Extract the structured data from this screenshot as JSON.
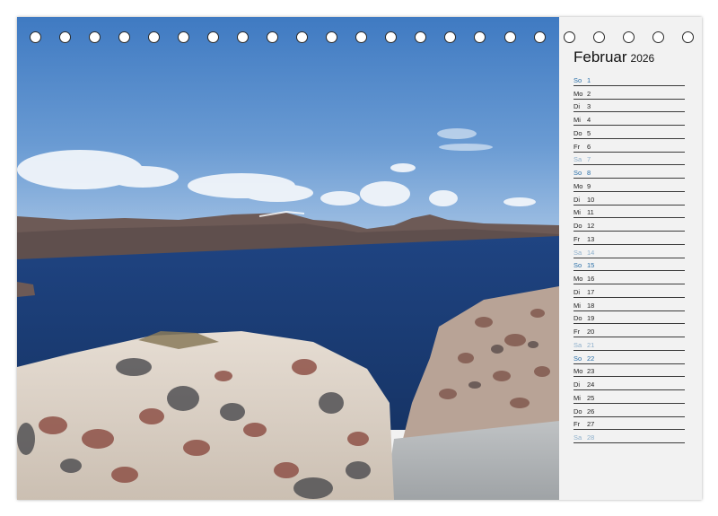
{
  "calendar": {
    "month": "Februar",
    "year": "2026",
    "days": [
      {
        "wd": "So",
        "d": "1",
        "type": "sun"
      },
      {
        "wd": "Mo",
        "d": "2",
        "type": "normal"
      },
      {
        "wd": "Di",
        "d": "3",
        "type": "normal"
      },
      {
        "wd": "Mi",
        "d": "4",
        "type": "normal"
      },
      {
        "wd": "Do",
        "d": "5",
        "type": "normal"
      },
      {
        "wd": "Fr",
        "d": "6",
        "type": "normal"
      },
      {
        "wd": "Sa",
        "d": "7",
        "type": "sat"
      },
      {
        "wd": "So",
        "d": "8",
        "type": "sun"
      },
      {
        "wd": "Mo",
        "d": "9",
        "type": "normal"
      },
      {
        "wd": "Di",
        "d": "10",
        "type": "normal"
      },
      {
        "wd": "Mi",
        "d": "11",
        "type": "normal"
      },
      {
        "wd": "Do",
        "d": "12",
        "type": "normal"
      },
      {
        "wd": "Fr",
        "d": "13",
        "type": "normal"
      },
      {
        "wd": "Sa",
        "d": "14",
        "type": "sat"
      },
      {
        "wd": "So",
        "d": "15",
        "type": "sun"
      },
      {
        "wd": "Mo",
        "d": "16",
        "type": "normal"
      },
      {
        "wd": "Di",
        "d": "17",
        "type": "normal"
      },
      {
        "wd": "Mi",
        "d": "18",
        "type": "normal"
      },
      {
        "wd": "Do",
        "d": "19",
        "type": "normal"
      },
      {
        "wd": "Fr",
        "d": "20",
        "type": "normal"
      },
      {
        "wd": "Sa",
        "d": "21",
        "type": "sat"
      },
      {
        "wd": "So",
        "d": "22",
        "type": "sun"
      },
      {
        "wd": "Mo",
        "d": "23",
        "type": "normal"
      },
      {
        "wd": "Di",
        "d": "24",
        "type": "normal"
      },
      {
        "wd": "Mi",
        "d": "25",
        "type": "normal"
      },
      {
        "wd": "Do",
        "d": "26",
        "type": "normal"
      },
      {
        "wd": "Fr",
        "d": "27",
        "type": "normal"
      },
      {
        "wd": "Sa",
        "d": "28",
        "type": "sat"
      }
    ]
  },
  "binding_rings": 23,
  "colors": {
    "sunday": "#2a6fa8",
    "saturday": "#8fb0cc",
    "sea": "#1d3f7a",
    "sky": "#4d86c8"
  }
}
